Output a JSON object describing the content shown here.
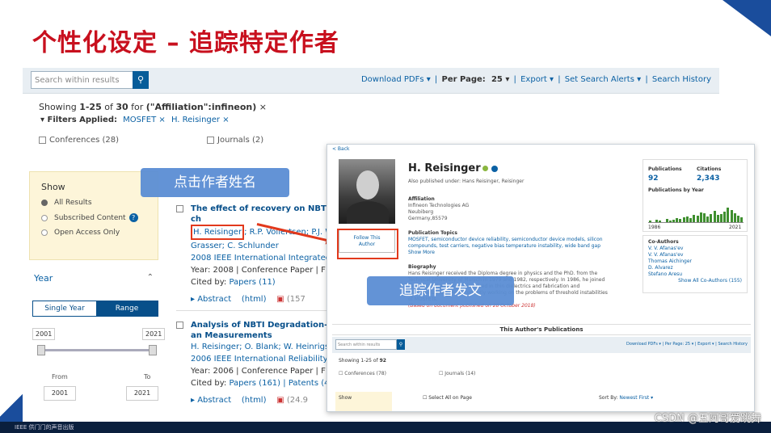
{
  "slide": {
    "title": "个性化设定 – 追踪特定作者",
    "callout_author": "点击作者姓名",
    "callout_follow": "追踪作者发文",
    "watermark": "CSDN @五阿哥爱跳舞"
  },
  "colors": {
    "title_red": "#c8101e",
    "ieee_blue": "#074f8a",
    "callout_blue": "#5b8ed4",
    "highlight_red": "#e2391c"
  },
  "toolbar": {
    "search_placeholder": "Search within results",
    "search_icon": "search-icon",
    "download_pdfs": "Download PDFs ▾",
    "per_page_label": "Per Page:",
    "per_page_value": "25 ▾",
    "export": "Export ▾",
    "set_alerts": "Set Search Alerts ▾",
    "search_history": "Search History"
  },
  "results_header": {
    "showing_prefix": "Showing",
    "range": "1-25",
    "of_label": "of",
    "total": "30",
    "for_label": "for",
    "query": "(\"Affiliation\":infineon)",
    "filters_label": "Filters Applied:",
    "filter_1": "MOSFET",
    "filter_2": "H. Reisinger",
    "facet_conferences": "Conferences (28)",
    "facet_journals": "Journals (2)"
  },
  "sidebar": {
    "show_heading": "Show",
    "opt_all": "All Results",
    "opt_subscribed": "Subscribed Content",
    "opt_open": "Open Access Only",
    "year_heading": "Year",
    "seg_single": "Single Year",
    "seg_range": "Range",
    "year_min": "2001",
    "year_max": "2021",
    "from_label": "From",
    "to_label": "To",
    "from_value": "2001",
    "to_value": "2021"
  },
  "results": [
    {
      "title": "The effect of recovery on NBTI ch",
      "first_author": "H. Reisinger",
      "other_authors": "; R.P. Vollertsen; P.J. W",
      "authors_line2": "Grasser; C. Schlunder",
      "venue": "2008 IEEE International Integrated",
      "meta": "Year: 2008 | Conference Paper | F",
      "cited_prefix": "Cited by:",
      "cited_link": "Papers (11)",
      "abstract": "▸ Abstract",
      "html": "(html)",
      "pdf_count": "(157"
    },
    {
      "title": "Analysis of NBTI Degradation- an Measurements",
      "authors": "H. Reisinger; O. Blank; W. Heinrigs; ",
      "venue": "2006 IEEE International Reliability F",
      "meta": "Year: 2006 | Conference Paper | F",
      "cited_prefix": "Cited by:",
      "cited_link": "Papers (161)",
      "patents": "| Patents (4",
      "abstract": "▸ Abstract",
      "html": "(html)",
      "pdf_count": "(24.9"
    }
  ],
  "profile": {
    "back": "< Back",
    "name": "H. Reisinger",
    "also_published": "Also published under: Hans Reisinger, Reisinger",
    "follow_line1": "Follow This",
    "follow_line2": "Author",
    "affiliation_heading": "Affiliation",
    "affiliation_1": "Infineon Technologies AG",
    "affiliation_2": "Neubiberg",
    "affiliation_3": "Germany,85579",
    "topics_heading": "Publication Topics",
    "topics": "MOSFET, semiconductor device reliability, semiconductor device models, silicon compounds, test carriers, negative bias temperature instability, wide band gap",
    "show_more": "Show More",
    "bio_heading": "Biography",
    "bio": "Hans Reisinger received the Diploma degree in physics and the PhD. from the Technical University of Munich in 1979 and 1982, respectively. In 1986, he joined Siemens, where he was involved in thin dielectrics and fabrication and characterization. He is currently working on the problems of threshold instabilities of MOSFETs.",
    "bio_note": "(Based on document published on 28 October 2018)",
    "publications_label": "Publications",
    "publications_value": "92",
    "citations_label": "Citations",
    "citations_value": "2,343",
    "by_year_label": "Publications by Year",
    "year_start": "1986",
    "year_end": "2021",
    "bar_levels": [
      0.1,
      0.0,
      0.15,
      0.1,
      0.0,
      0.2,
      0.1,
      0.15,
      0.25,
      0.2,
      0.3,
      0.35,
      0.25,
      0.45,
      0.4,
      0.6,
      0.55,
      0.35,
      0.5,
      0.7,
      0.45,
      0.5,
      0.65,
      0.9,
      0.75,
      0.55,
      0.4,
      0.3
    ],
    "coauthors_heading": "Co-Authors",
    "coauthors": [
      "V. V. Afanas'ev",
      "V. V. Afanas'ev",
      "Thomas Aichinger",
      "D. Alvarez",
      "Stefano Aresu"
    ],
    "show_all_coauthors": "Show All Co-Authors (155)",
    "pubs_header": "This Author's Publications",
    "search_placeholder": "Search within results",
    "download_pdfs": "Download PDFs ▾",
    "per_page": "Per Page: 25 ▾",
    "export": "Export ▾",
    "search_history": "Search History",
    "showing_prefix": "Showing 1-25 of",
    "showing_total": "92",
    "facet_conferences": "Conferences (78)",
    "facet_journals": "Journals (14)",
    "show_heading": "Show",
    "select_all": "Select All on Page",
    "sort_label": "Sort By:",
    "sort_value": "Newest First ▾"
  },
  "taskbar": {
    "label": "IEEE 供门门的声音出版"
  }
}
